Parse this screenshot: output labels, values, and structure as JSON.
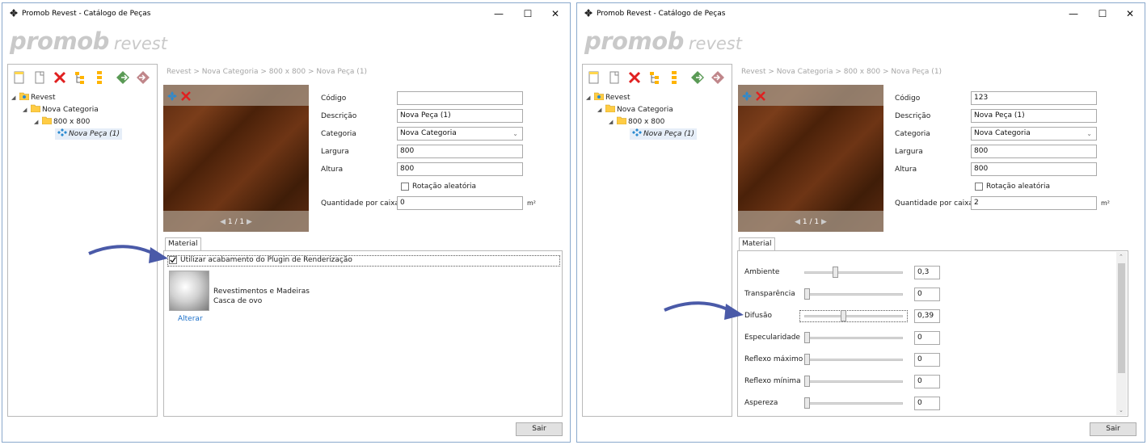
{
  "windows": [
    {
      "title": "Promob Revest - Catálogo de Peças",
      "logo": {
        "brand": "promob",
        "product": "revest"
      },
      "tree": {
        "root": "Revest",
        "category": "Nova Categoria",
        "size": "800 x 800",
        "piece": "Nova Peça (1)"
      },
      "breadcrumb": "Revest > Nova Categoria > 800 x 800 > Nova Peça (1)",
      "texture_pager": "1 / 1",
      "form": {
        "codigo_label": "Código",
        "codigo_value": "",
        "descricao_label": "Descrição",
        "descricao_value": "Nova Peça (1)",
        "categoria_label": "Categoria",
        "categoria_value": "Nova Categoria",
        "largura_label": "Largura",
        "largura_value": "800",
        "altura_label": "Altura",
        "altura_value": "800",
        "rotacao_label": "Rotação aleatória",
        "qtd_label": "Quantidade por caixa",
        "qtd_value": "0",
        "unit": "m²"
      },
      "tab_label": "Material",
      "material": {
        "use_plugin_label": "Utilizar acabamento do Plugin de Renderização",
        "use_plugin_checked": true,
        "line1": "Revestimentos e Madeiras",
        "line2": "Casca de ovo",
        "change_label": "Alterar"
      },
      "exit_label": "Sair"
    },
    {
      "title": "Promob Revest - Catálogo de Peças",
      "logo": {
        "brand": "promob",
        "product": "revest"
      },
      "tree": {
        "root": "Revest",
        "category": "Nova Categoria",
        "size": "800 x 800",
        "piece": "Nova Peça (1)"
      },
      "breadcrumb": "Revest > Nova Categoria > 800 x 800 > Nova Peça (1)",
      "texture_pager": "1 / 1",
      "form": {
        "codigo_label": "Código",
        "codigo_value": "123",
        "descricao_label": "Descrição",
        "descricao_value": "Nova Peça (1)",
        "categoria_label": "Categoria",
        "categoria_value": "Nova Categoria",
        "largura_label": "Largura",
        "largura_value": "800",
        "altura_label": "Altura",
        "altura_value": "800",
        "rotacao_label": "Rotação aleatória",
        "qtd_label": "Quantidade por caixa",
        "qtd_value": "2",
        "unit": "m²"
      },
      "tab_label": "Material",
      "sliders": [
        {
          "label": "Ambiente",
          "value": "0,3",
          "level": 0.3
        },
        {
          "label": "Transparência",
          "value": "0",
          "level": 0
        },
        {
          "label": "Difusão",
          "value": "0,39",
          "level": 0.39
        },
        {
          "label": "Especularidade",
          "value": "0",
          "level": 0
        },
        {
          "label": "Reflexo máximo",
          "value": "0",
          "level": 0
        },
        {
          "label": "Reflexo mínima",
          "value": "0",
          "level": 0
        },
        {
          "label": "Aspereza",
          "value": "0",
          "level": 0
        }
      ],
      "exit_label": "Sair"
    }
  ],
  "colors": {
    "accent_link": "#1a6fc9",
    "arrow": "#4a5aa8",
    "window_border": "#8aa9cc"
  },
  "icons": [
    "app-icon",
    "new-icon",
    "copy-icon",
    "delete-icon",
    "tree-expand-icon",
    "tree-collapse-icon",
    "import-icon",
    "export-icon",
    "folder-icon",
    "piece-icon",
    "add-texture-icon",
    "remove-texture-icon",
    "arrow-annotation-icon"
  ]
}
